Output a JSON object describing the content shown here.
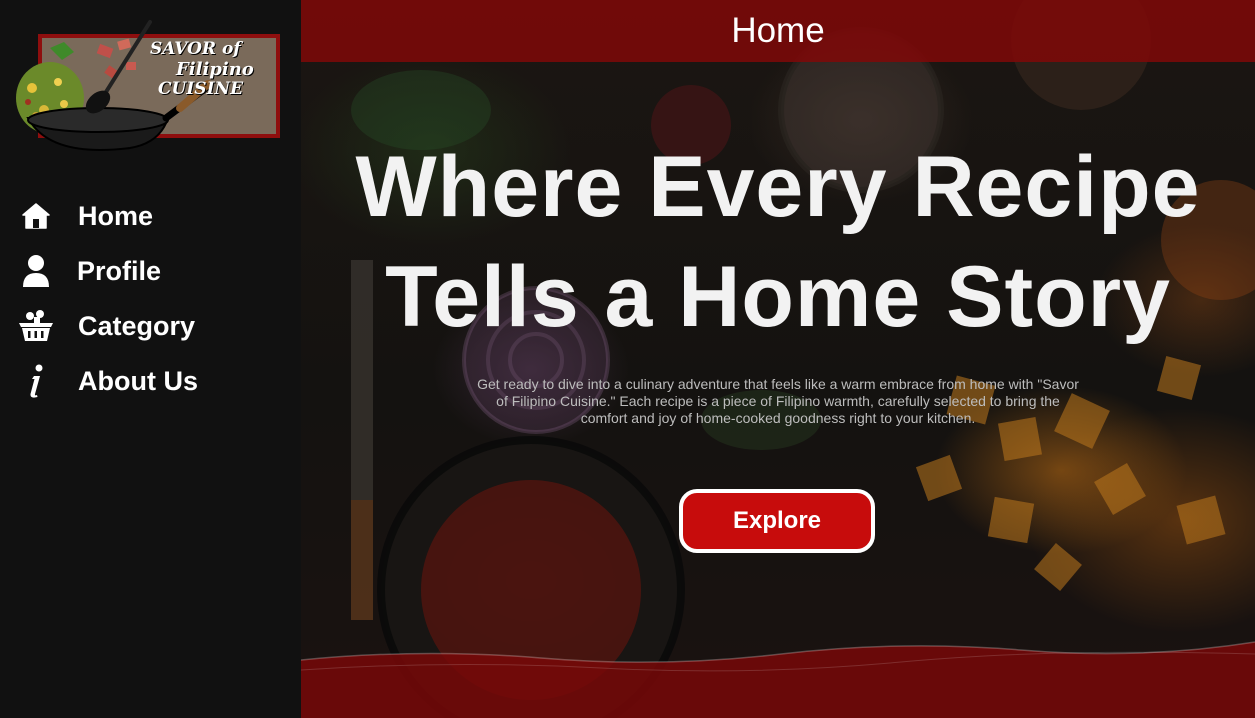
{
  "logo": {
    "line1": "SAVOR of",
    "line2": "Filipino",
    "line3": "CUISINE"
  },
  "sidebar": {
    "items": [
      {
        "label": "Home",
        "icon": "home-icon"
      },
      {
        "label": "Profile",
        "icon": "user-icon"
      },
      {
        "label": "Category",
        "icon": "basket-icon"
      },
      {
        "label": "About Us",
        "icon": "info-icon"
      }
    ]
  },
  "header": {
    "title": "Home"
  },
  "hero": {
    "headline_line1": "Where Every Recipe",
    "headline_line2": "Tells a Home Story",
    "subtext": "Get ready to dive into a culinary adventure that feels like a warm embrace from home with \"Savor of Filipino Cuisine.\" Each recipe is a piece of Filipino warmth, carefully selected to bring the comfort and joy of home-cooked goodness right to your kitchen.",
    "button_label": "Explore"
  },
  "colors": {
    "sidebar_bg": "#111111",
    "accent_red": "#c70c0c",
    "header_red": "#800808",
    "text_white": "#ffffff"
  }
}
